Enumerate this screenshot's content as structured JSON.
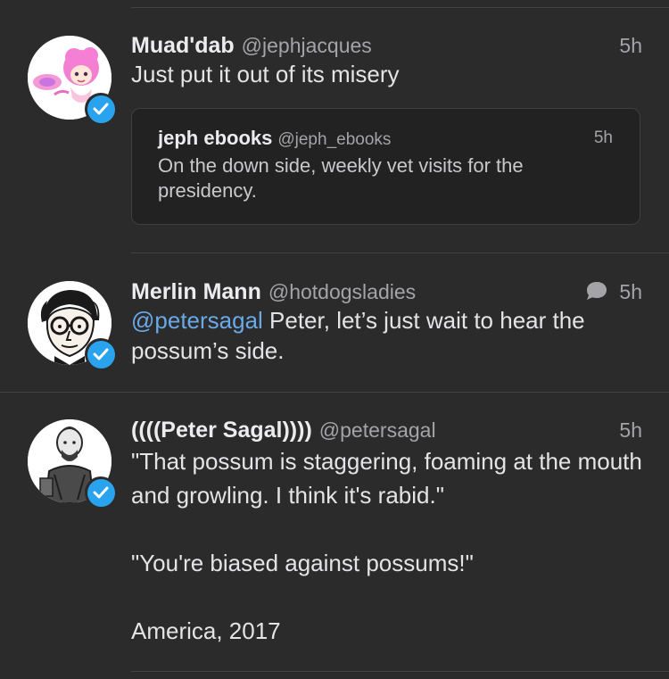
{
  "tweets": [
    {
      "name": "Muad'dab",
      "handle": "@jephjacques",
      "time": "5h",
      "text": "Just put it out of its misery",
      "avatar_icon": "pink-anime-character-avatar",
      "verified": true,
      "quoted": {
        "name": "jeph ebooks",
        "handle": "@jeph_ebooks",
        "time": "5h",
        "text": "On the down side, weekly vet visits for the presidency."
      }
    },
    {
      "name": "Merlin Mann",
      "handle": "@hotdogsladies",
      "time": "5h",
      "reply_icon": "speech-bubble-icon",
      "mention": "@petersagal",
      "text": " Peter, let’s just wait to hear the possum’s side.",
      "avatar_icon": "cartoon-man-glasses-avatar",
      "verified": true
    },
    {
      "name": "((((Peter Sagal))))",
      "handle": "@petersagal",
      "time": "5h",
      "paragraphs": [
        "\"That possum is staggering, foaming at the mouth and growling. I think it's rabid.\"",
        "\"You're biased against possums!\"",
        "America, 2017"
      ],
      "avatar_icon": "caricature-man-bald-avatar",
      "verified": true
    }
  ],
  "colors": {
    "background": "#2b2b2c",
    "accent_blue": "#2aa3ef",
    "mention": "#6aa9e8",
    "secondary_text": "#a4a4a8"
  }
}
